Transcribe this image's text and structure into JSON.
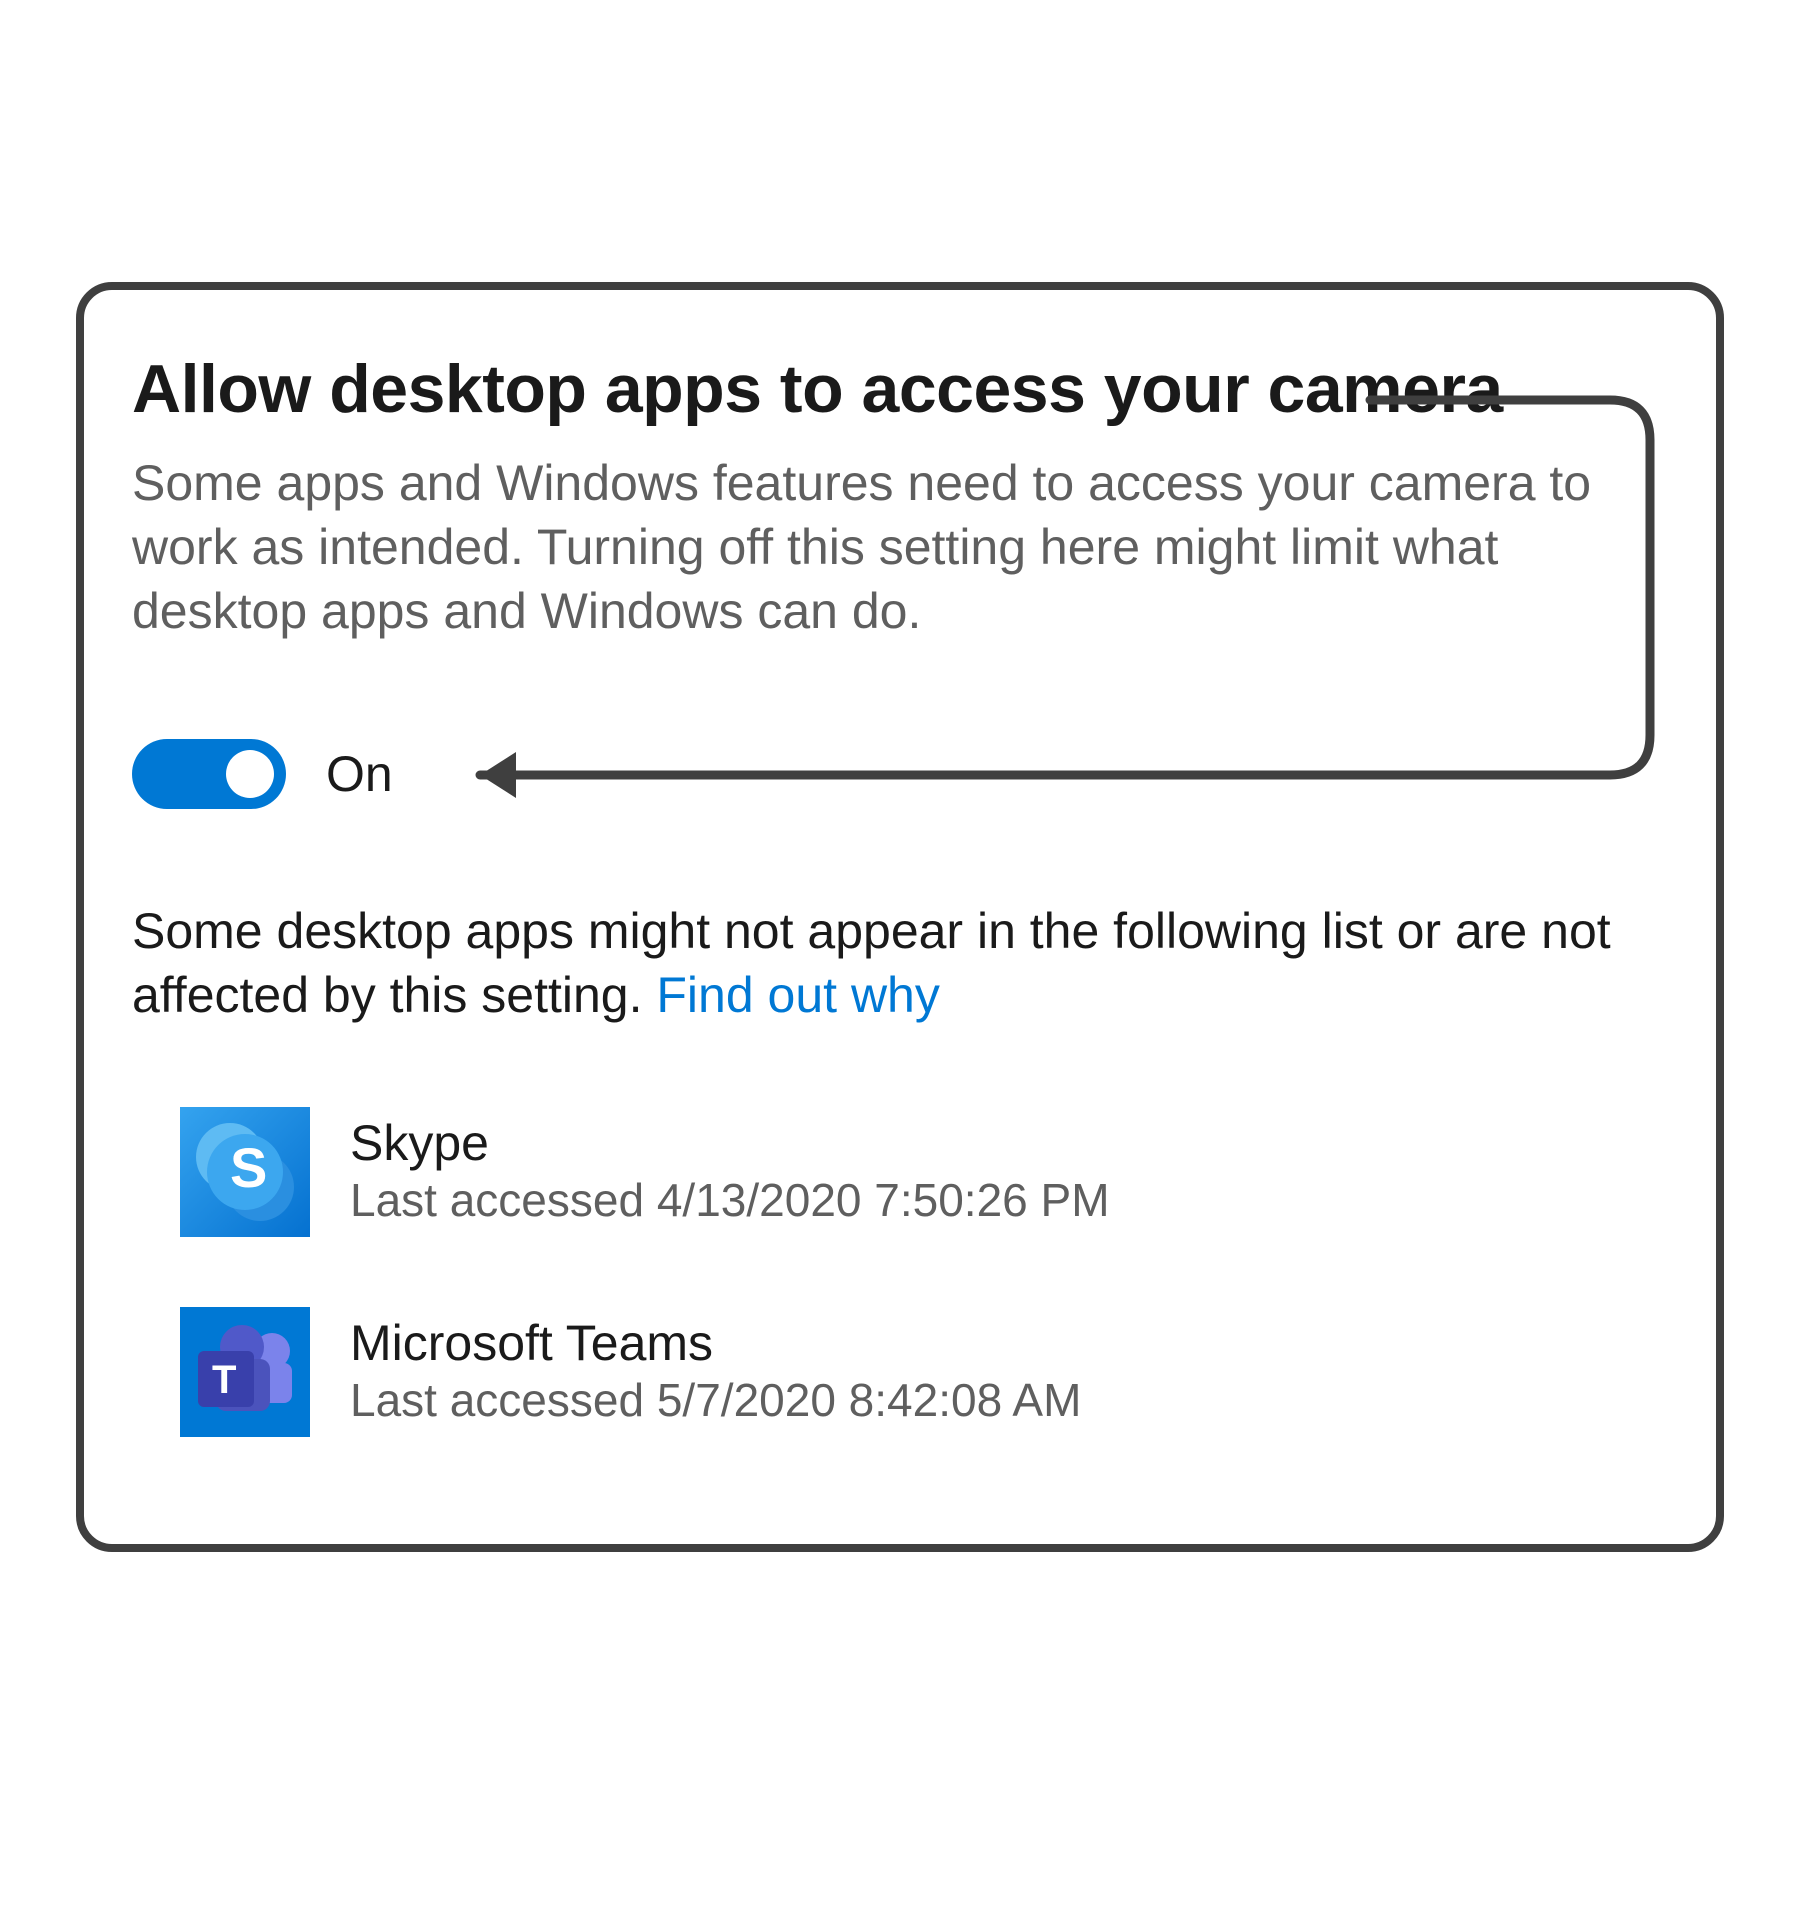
{
  "section": {
    "title": "Allow desktop apps to access your camera",
    "description": "Some apps and Windows features need to access your camera to work as intended. Turning off this setting here might limit what desktop apps and Windows can do."
  },
  "toggle": {
    "state": "on",
    "label": "On",
    "accent": "#0078d4"
  },
  "note": {
    "text": "Some desktop apps might not appear in the following list or are not affected by this setting. ",
    "link": "Find out why"
  },
  "apps": [
    {
      "name": "Skype",
      "last_accessed": "Last accessed 4/13/2020 7:50:26 PM",
      "icon": "skype-icon",
      "letter": "S"
    },
    {
      "name": "Microsoft Teams",
      "last_accessed": "Last accessed 5/7/2020 8:42:08 AM",
      "icon": "teams-icon",
      "letter": "T"
    }
  ]
}
